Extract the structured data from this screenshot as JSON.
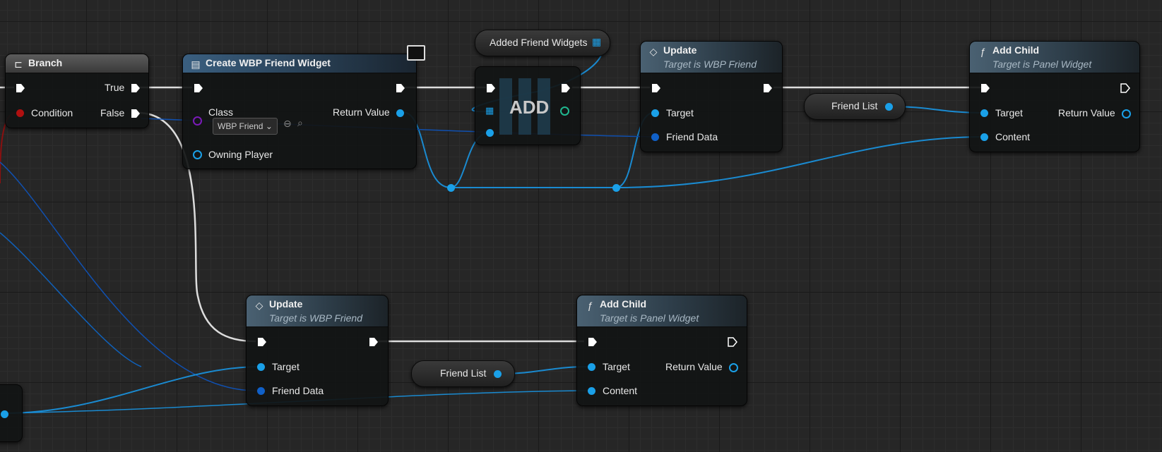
{
  "nodes": {
    "branch": {
      "title": "Branch",
      "true_label": "True",
      "condition_label": "Condition",
      "false_label": "False"
    },
    "create_widget": {
      "title": "Create WBP Friend Widget",
      "class_label": "Class",
      "class_value": "WBP Friend",
      "return_label": "Return Value",
      "owning_label": "Owning Player"
    },
    "added_var": {
      "label": "Added Friend Widgets"
    },
    "add_node": {
      "label": "ADD"
    },
    "update_top": {
      "title": "Update",
      "subtitle": "Target is WBP Friend",
      "target_label": "Target",
      "data_label": "Friend Data"
    },
    "friend_list_top": {
      "label": "Friend List"
    },
    "add_child_top": {
      "title": "Add Child",
      "subtitle": "Target is Panel Widget",
      "target_label": "Target",
      "return_label": "Return Value",
      "content_label": "Content"
    },
    "update_bottom": {
      "title": "Update",
      "subtitle": "Target is WBP Friend",
      "target_label": "Target",
      "data_label": "Friend Data"
    },
    "friend_list_bottom": {
      "label": "Friend List"
    },
    "add_child_bottom": {
      "title": "Add Child",
      "subtitle": "Target is Panel Widget",
      "target_label": "Target",
      "return_label": "Return Value",
      "content_label": "Content"
    }
  },
  "colors": {
    "exec": "#ffffff",
    "object": "#1aa0e8",
    "struct": "#1060c8",
    "bool": "#b01010",
    "class": "#7a1ab8"
  },
  "icons": {
    "branch": "branch-icon",
    "function": "function-icon",
    "event": "event-diamond-icon",
    "widget": "widget-icon",
    "array": "array-grid-icon",
    "monitor": "monitor-icon"
  }
}
